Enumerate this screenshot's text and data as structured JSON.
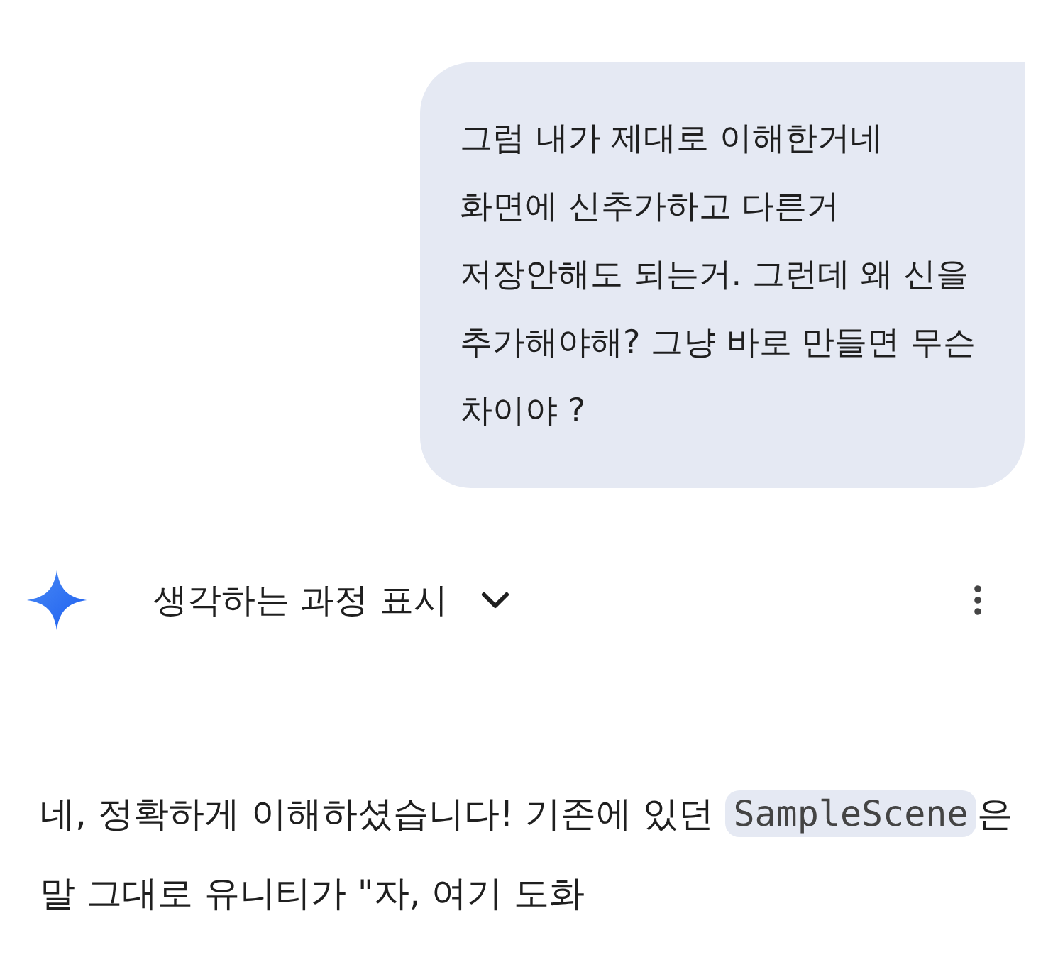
{
  "user_message": {
    "text": "그럼 내가 제대로 이해한거네 화면에 신추가하고 다른거 저장안해도 되는거. 그런데 왜 신을 추가해야해? 그냥 바로 만들면 무슨 차이야 ?"
  },
  "response": {
    "thinking_toggle": {
      "label": "생각하는 과정 표시",
      "expanded": false
    },
    "paragraph": {
      "before": "네, 정확하게 이해하셨습니다! 기존에 있던 ",
      "code": "SampleScene",
      "after": "은 말 그대로 유니티가 \"자, 여기 도화"
    }
  }
}
